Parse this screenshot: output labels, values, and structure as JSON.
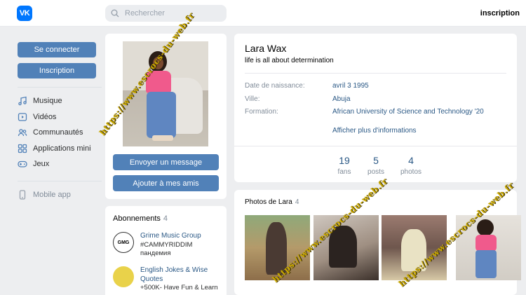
{
  "header": {
    "logo_text": "VK",
    "search_placeholder": "Rechercher",
    "signup_label": "inscription"
  },
  "sidebar": {
    "login_label": "Se connecter",
    "register_label": "Inscription",
    "items": [
      {
        "label": "Musique",
        "icon": "music-icon"
      },
      {
        "label": "Vidéos",
        "icon": "video-icon"
      },
      {
        "label": "Communautés",
        "icon": "communities-icon"
      },
      {
        "label": "Applications mini",
        "icon": "apps-icon"
      },
      {
        "label": "Jeux",
        "icon": "gamepad-icon"
      }
    ],
    "mobile_label": "Mobile app"
  },
  "profile": {
    "name": "Lara Wax",
    "status": "life is all about determination",
    "fields": [
      {
        "label": "Date de naissance:",
        "value": "avril 3 1995"
      },
      {
        "label": "Ville:",
        "value": "Abuja"
      },
      {
        "label": "Formation:",
        "value": "African University of Science and Technology '20"
      }
    ],
    "more_label": "Afficher plus d'informations",
    "counters": [
      {
        "num": "19",
        "label": "fans"
      },
      {
        "num": "5",
        "label": "posts"
      },
      {
        "num": "4",
        "label": "photos"
      }
    ],
    "message_button": "Envoyer un message",
    "add_friend_button": "Ajouter à mes amis"
  },
  "subscriptions": {
    "title": "Abonnements",
    "count": "4",
    "items": [
      {
        "name": "Grime Music Group",
        "desc1": "#CAMMYRIDDIM",
        "desc2": "пандемия",
        "icon_text": "GMG"
      },
      {
        "name": "English Jokes & Wise Quotes",
        "desc1": "+500K- Have Fun & Learn",
        "desc2": "",
        "icon_text": ""
      }
    ]
  },
  "photos": {
    "title": "Photos de Lara",
    "count": "4"
  },
  "watermark": "https://www.escrocs-du-web.fr",
  "colors": {
    "accent": "#5181b8",
    "link": "#2a5885",
    "logo": "#0077ff",
    "background": "#edeef0"
  }
}
